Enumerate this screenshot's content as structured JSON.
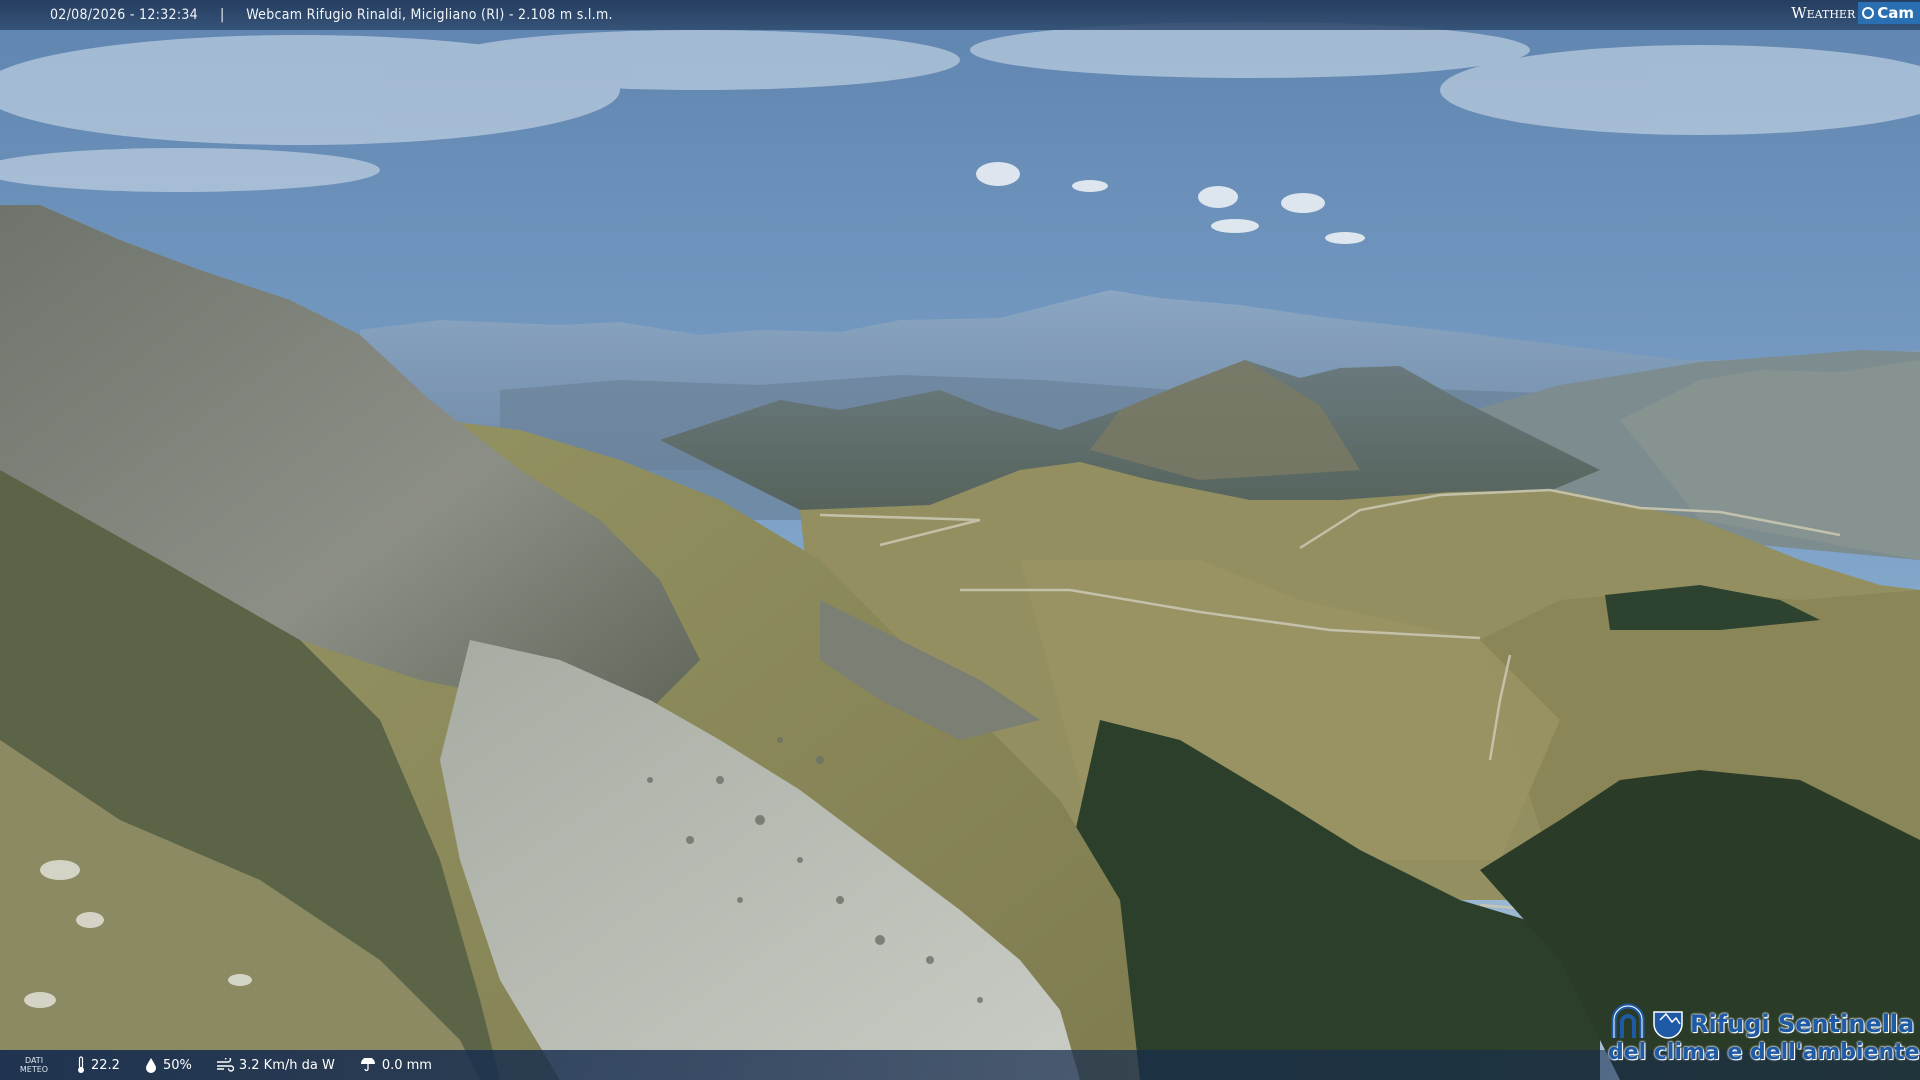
{
  "overlay": {
    "datetime": "02/08/2026 - 12:32:34",
    "separator": "|",
    "station": "Webcam Rifugio Rinaldi, Micigliano (RI) - 2.108 m s.l.m.",
    "brand_weather": "Weather",
    "brand_cam": "Cam"
  },
  "weather": {
    "label": "DATI METEO",
    "temperature": "22.2",
    "humidity": "50%",
    "wind": "3.2 Km/h da W",
    "rain": "0.0 mm"
  },
  "logo": {
    "line1": "Rifugi Sentinella",
    "line2": "del clima e dell'ambiente"
  },
  "icons": {
    "temperature": "thermometer-icon",
    "humidity": "droplet-icon",
    "wind": "wind-icon",
    "rain": "rain-icon"
  },
  "colors": {
    "sky": "#7fa3c9",
    "distant_mountains": "#6f8aa8",
    "grass_slope": "#8a8a5a",
    "rock_face": "#7a7d73",
    "scree": "#b8bcb4",
    "forest": "#2c3f2a",
    "overlay_bar": "#223a5c",
    "logo_blue": "#1e5aa6"
  }
}
